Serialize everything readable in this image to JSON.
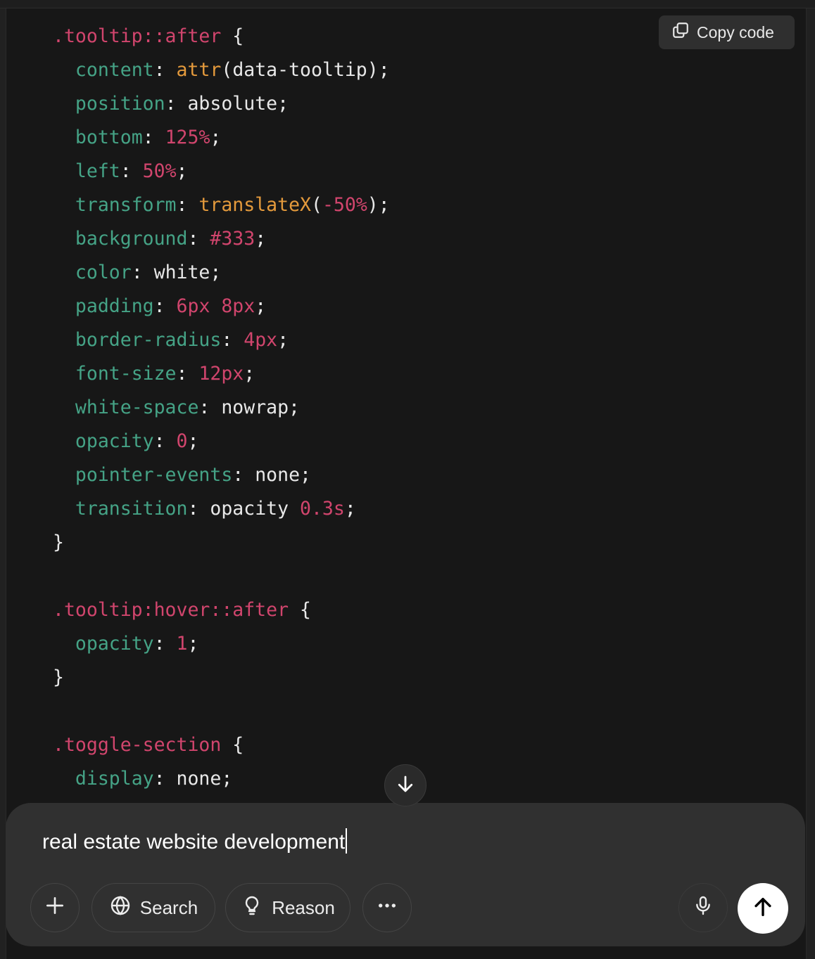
{
  "toolbar": {
    "copy_label": "Copy code"
  },
  "code": {
    "lines": [
      [
        {
          "t": ".tooltip::after",
          "c": "sel"
        },
        {
          "t": " {"
        }
      ],
      [
        {
          "t": "  "
        },
        {
          "t": "content",
          "c": "prop"
        },
        {
          "t": ": "
        },
        {
          "t": "attr",
          "c": "fn"
        },
        {
          "t": "(data-tooltip);"
        }
      ],
      [
        {
          "t": "  "
        },
        {
          "t": "position",
          "c": "prop"
        },
        {
          "t": ": absolute;"
        }
      ],
      [
        {
          "t": "  "
        },
        {
          "t": "bottom",
          "c": "prop"
        },
        {
          "t": ": "
        },
        {
          "t": "125%",
          "c": "num"
        },
        {
          "t": ";"
        }
      ],
      [
        {
          "t": "  "
        },
        {
          "t": "left",
          "c": "prop"
        },
        {
          "t": ": "
        },
        {
          "t": "50%",
          "c": "num"
        },
        {
          "t": ";"
        }
      ],
      [
        {
          "t": "  "
        },
        {
          "t": "transform",
          "c": "prop"
        },
        {
          "t": ": "
        },
        {
          "t": "translateX",
          "c": "fn"
        },
        {
          "t": "("
        },
        {
          "t": "-50%",
          "c": "num"
        },
        {
          "t": ");"
        }
      ],
      [
        {
          "t": "  "
        },
        {
          "t": "background",
          "c": "prop"
        },
        {
          "t": ": "
        },
        {
          "t": "#333",
          "c": "num"
        },
        {
          "t": ";"
        }
      ],
      [
        {
          "t": "  "
        },
        {
          "t": "color",
          "c": "prop"
        },
        {
          "t": ": white;"
        }
      ],
      [
        {
          "t": "  "
        },
        {
          "t": "padding",
          "c": "prop"
        },
        {
          "t": ": "
        },
        {
          "t": "6px 8px",
          "c": "num"
        },
        {
          "t": ";"
        }
      ],
      [
        {
          "t": "  "
        },
        {
          "t": "border-radius",
          "c": "prop"
        },
        {
          "t": ": "
        },
        {
          "t": "4px",
          "c": "num"
        },
        {
          "t": ";"
        }
      ],
      [
        {
          "t": "  "
        },
        {
          "t": "font-size",
          "c": "prop"
        },
        {
          "t": ": "
        },
        {
          "t": "12px",
          "c": "num"
        },
        {
          "t": ";"
        }
      ],
      [
        {
          "t": "  "
        },
        {
          "t": "white-space",
          "c": "prop"
        },
        {
          "t": ": nowrap;"
        }
      ],
      [
        {
          "t": "  "
        },
        {
          "t": "opacity",
          "c": "prop"
        },
        {
          "t": ": "
        },
        {
          "t": "0",
          "c": "num"
        },
        {
          "t": ";"
        }
      ],
      [
        {
          "t": "  "
        },
        {
          "t": "pointer-events",
          "c": "prop"
        },
        {
          "t": ": none;"
        }
      ],
      [
        {
          "t": "  "
        },
        {
          "t": "transition",
          "c": "prop"
        },
        {
          "t": ": opacity "
        },
        {
          "t": "0.3s",
          "c": "num"
        },
        {
          "t": ";"
        }
      ],
      [
        {
          "t": "}"
        }
      ],
      [],
      [
        {
          "t": ".tooltip:hover::after",
          "c": "sel"
        },
        {
          "t": " {"
        }
      ],
      [
        {
          "t": "  "
        },
        {
          "t": "opacity",
          "c": "prop"
        },
        {
          "t": ": "
        },
        {
          "t": "1",
          "c": "num"
        },
        {
          "t": ";"
        }
      ],
      [
        {
          "t": "}"
        }
      ],
      [],
      [
        {
          "t": ".toggle-section",
          "c": "sel"
        },
        {
          "t": " {"
        }
      ],
      [
        {
          "t": "  "
        },
        {
          "t": "display",
          "c": "prop"
        },
        {
          "t": ": none;"
        }
      ]
    ]
  },
  "composer": {
    "input_value": "real estate website development",
    "search_label": "Search",
    "reason_label": "Reason"
  },
  "icons": {
    "copy": "copy-icon",
    "scroll": "arrow-down-icon",
    "add": "plus-icon",
    "search": "globe-icon",
    "reason": "lightbulb-icon",
    "more": "ellipsis-icon",
    "mic": "microphone-icon",
    "send": "arrow-up-icon"
  },
  "colors": {
    "background": "#171717",
    "composer": "#303030",
    "selector": "#d1456d",
    "property": "#45a386",
    "number": "#d1456d",
    "function": "#e49a3c"
  }
}
